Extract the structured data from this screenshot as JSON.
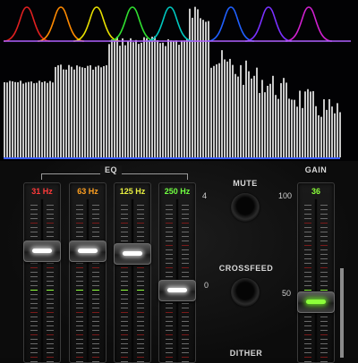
{
  "visualizer": {
    "eq_curves": [
      {
        "color": "#e02020"
      },
      {
        "color": "#ff8a00"
      },
      {
        "color": "#e8e000"
      },
      {
        "color": "#30e030"
      },
      {
        "color": "#00c8c0"
      },
      {
        "color": "#2060ff"
      },
      {
        "color": "#7a30ff"
      },
      {
        "color": "#d020d0"
      }
    ]
  },
  "eq": {
    "title": "EQ",
    "scale_top": "4",
    "scale_mid": "0",
    "bands": [
      {
        "label": "31 Hz",
        "color": "#ff3a3a",
        "level": 0.72
      },
      {
        "label": "63 Hz",
        "color": "#ffa020",
        "level": 0.72
      },
      {
        "label": "125 Hz",
        "color": "#e8f040",
        "level": 0.7
      },
      {
        "label": "250 Hz",
        "color": "#70ff40",
        "level": 0.44
      }
    ]
  },
  "controls": {
    "mute_label": "MUTE",
    "crossfeed_label": "CROSSFEED",
    "dither_label": "DITHER"
  },
  "gain": {
    "title": "GAIN",
    "value": "36",
    "scale_top": "100",
    "scale_mid": "50",
    "level": 0.36
  },
  "colors": {
    "accent_green": "#8cff3a",
    "spectrum_bars": "#c8c8c8",
    "baseline": "#3a5cff"
  }
}
